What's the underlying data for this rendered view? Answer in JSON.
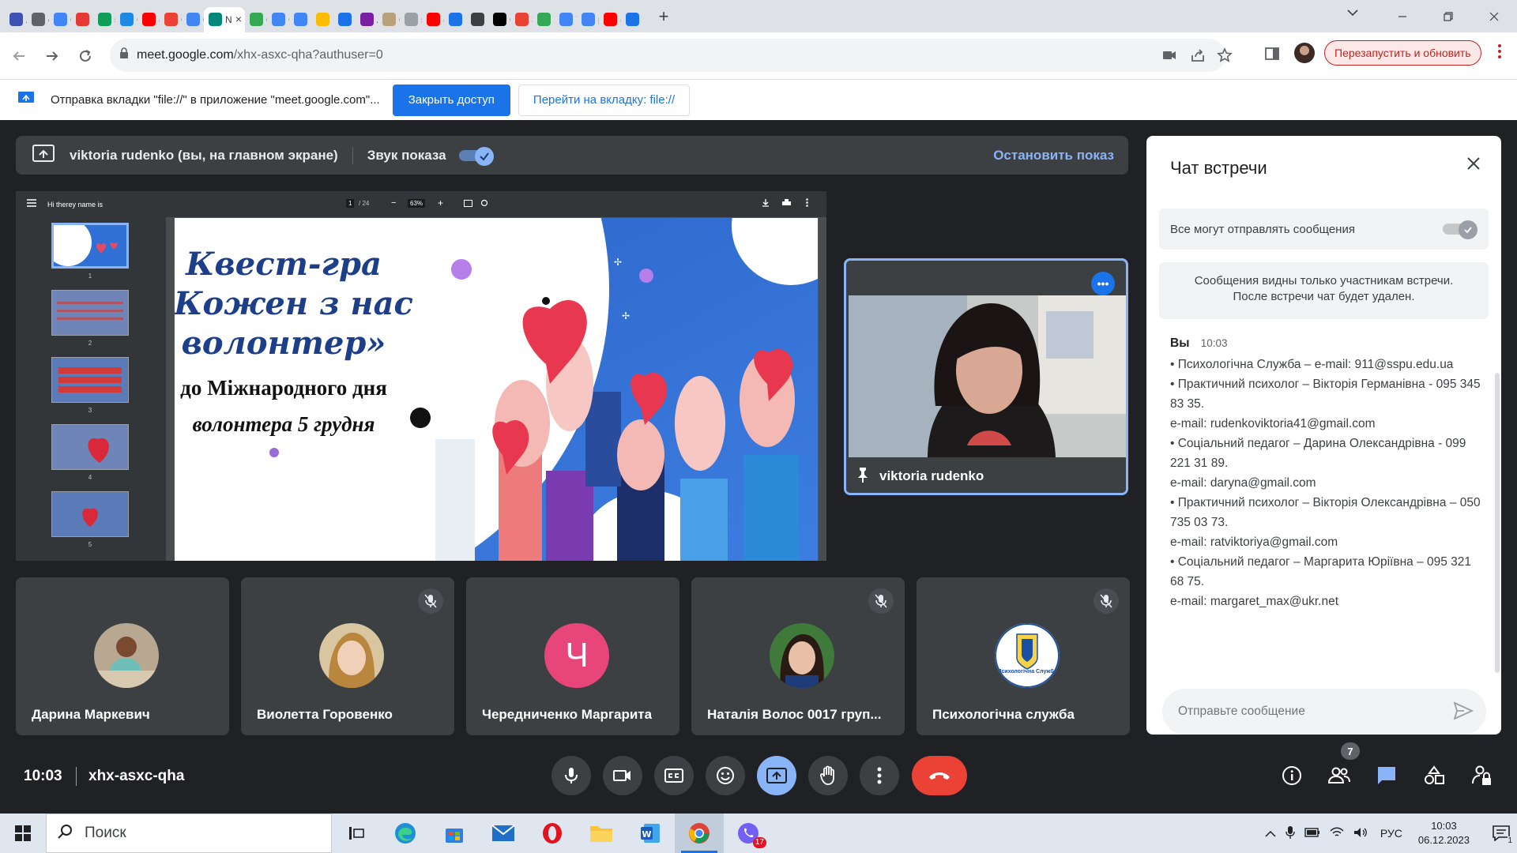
{
  "browser": {
    "tabs": [
      {
        "label": "Z",
        "color": "#3f51b5"
      },
      {
        "label": "e",
        "color": "#5f6368"
      },
      {
        "label": "C",
        "color": "#4285f4"
      },
      {
        "label": "K",
        "color": "#e53935"
      },
      {
        "label": "s",
        "color": "#0f9d58"
      },
      {
        "label": "C",
        "color": "#1e88e5"
      },
      {
        "label": "(",
        "color": "#ff0000"
      },
      {
        "label": "C",
        "color": "#ea4335"
      },
      {
        "label": "C",
        "color": "#4285f4"
      },
      {
        "label": "N",
        "color": "#00897b",
        "active": true
      },
      {
        "label": "C",
        "color": "#34a853"
      },
      {
        "label": "C",
        "color": "#4285f4"
      },
      {
        "label": "K",
        "color": "#4285f4"
      },
      {
        "label": "F",
        "color": "#fbbc04"
      },
      {
        "label": "P",
        "color": "#1a73e8"
      },
      {
        "label": "A",
        "color": "#7b1fa2"
      },
      {
        "label": "C",
        "color": "#b8a07a"
      },
      {
        "label": "s",
        "color": "#9aa0a6"
      },
      {
        "label": "(",
        "color": "#ff0000"
      },
      {
        "label": "Г",
        "color": "#1a73e8"
      },
      {
        "label": "E",
        "color": "#3c4043"
      },
      {
        "label": "C",
        "color": "#000000"
      },
      {
        "label": "3",
        "color": "#ea4335"
      },
      {
        "label": "B",
        "color": "#34a853"
      },
      {
        "label": "7",
        "color": "#4285f4"
      },
      {
        "label": "p",
        "color": "#4285f4"
      },
      {
        "label": "(",
        "color": "#ff0000"
      },
      {
        "label": "H",
        "color": "#1a73e8"
      }
    ],
    "url": "meet.google.com",
    "url_path": "/xhx-asxc-qha?authuser=0",
    "relaunch_label": "Перезапустить и обновить"
  },
  "infobar": {
    "text": "Отправка вкладки \"file://\" в приложение \"meet.google.com\"...",
    "close_access": "Закрыть доступ",
    "go_to_tab": "Перейти на вкладку: file://"
  },
  "presenting": {
    "text": "viktoria rudenko (вы, на главном экране)",
    "sound_label": "Звук показа",
    "sound_on": true,
    "stop_label": "Остановить показ"
  },
  "pdf": {
    "doc_title": "Hi therey name is",
    "page_current": "1",
    "page_total": "/ 24",
    "zoom": "63%",
    "thumb_numbers": [
      "1",
      "2",
      "3",
      "4",
      "5"
    ],
    "slide_title_line1": "Квест-гра",
    "slide_title_line2": "«Кожен з нас",
    "slide_title_line3": "волонтер»",
    "slide_sub_line1": "до Міжнародного дня",
    "slide_sub_line2": "волонтера 5 грудня"
  },
  "presenter_tile": {
    "name": "viktoria rudenko"
  },
  "participants": [
    {
      "name": "Дарина Маркевич",
      "muted": false,
      "avatar": "photo"
    },
    {
      "name": "Виолетта Горовенко",
      "muted": true,
      "avatar": "photo"
    },
    {
      "name": "Чередниченко Маргарита",
      "muted": false,
      "avatar": "letter",
      "letter": "Ч",
      "color": "#e8457a"
    },
    {
      "name": "Наталія Волос 0017 груп...",
      "muted": true,
      "avatar": "photo"
    },
    {
      "name": "Психологічна служба",
      "muted": true,
      "avatar": "logo",
      "logo_text": "Психологічна Служба"
    }
  ],
  "chat": {
    "title": "Чат встречи",
    "permission_label": "Все могут отправлять сообщения",
    "notice_line1": "Сообщения видны только участникам встречи.",
    "notice_line2": "После встречи чат будет удален.",
    "sender": "Вы",
    "time": "10:03",
    "lines": [
      "•      Психологічна Служба – e-mail: 911@sspu.edu.ua",
      "•      Практичний психолог – Вікторія Германівна - 095 345 83 35.",
      "e-mail: rudenkoviktoria41@gmail.com",
      "•      Соціальний педагог – Дарина Олександрівна - 099 221 31 89.",
      "e-mail: daryna@gmail.com",
      "•      Практичний психолог – Вікторія Олександрівна – 050 735 03 73.",
      "e-mail: ratviktoriya@gmail.com",
      "•      Соціальний педагог – Маргарита Юріївна – 095 321 68 75.",
      "e-mail: margaret_max@ukr.net"
    ],
    "input_placeholder": "Отправьте сообщение"
  },
  "bottom": {
    "time": "10:03",
    "meeting_code": "xhx-asxc-qha",
    "participant_count": "7"
  },
  "taskbar": {
    "search_label": "Поиск",
    "lang": "РУС",
    "clock_time": "10:03",
    "clock_date": "06.12.2023",
    "viber_badge": "17",
    "notif_count": "1"
  },
  "colors": {
    "meet_bg": "#202124",
    "accent": "#8ab4f8",
    "end_call": "#ea4335",
    "chrome_blue": "#1a73e8"
  }
}
